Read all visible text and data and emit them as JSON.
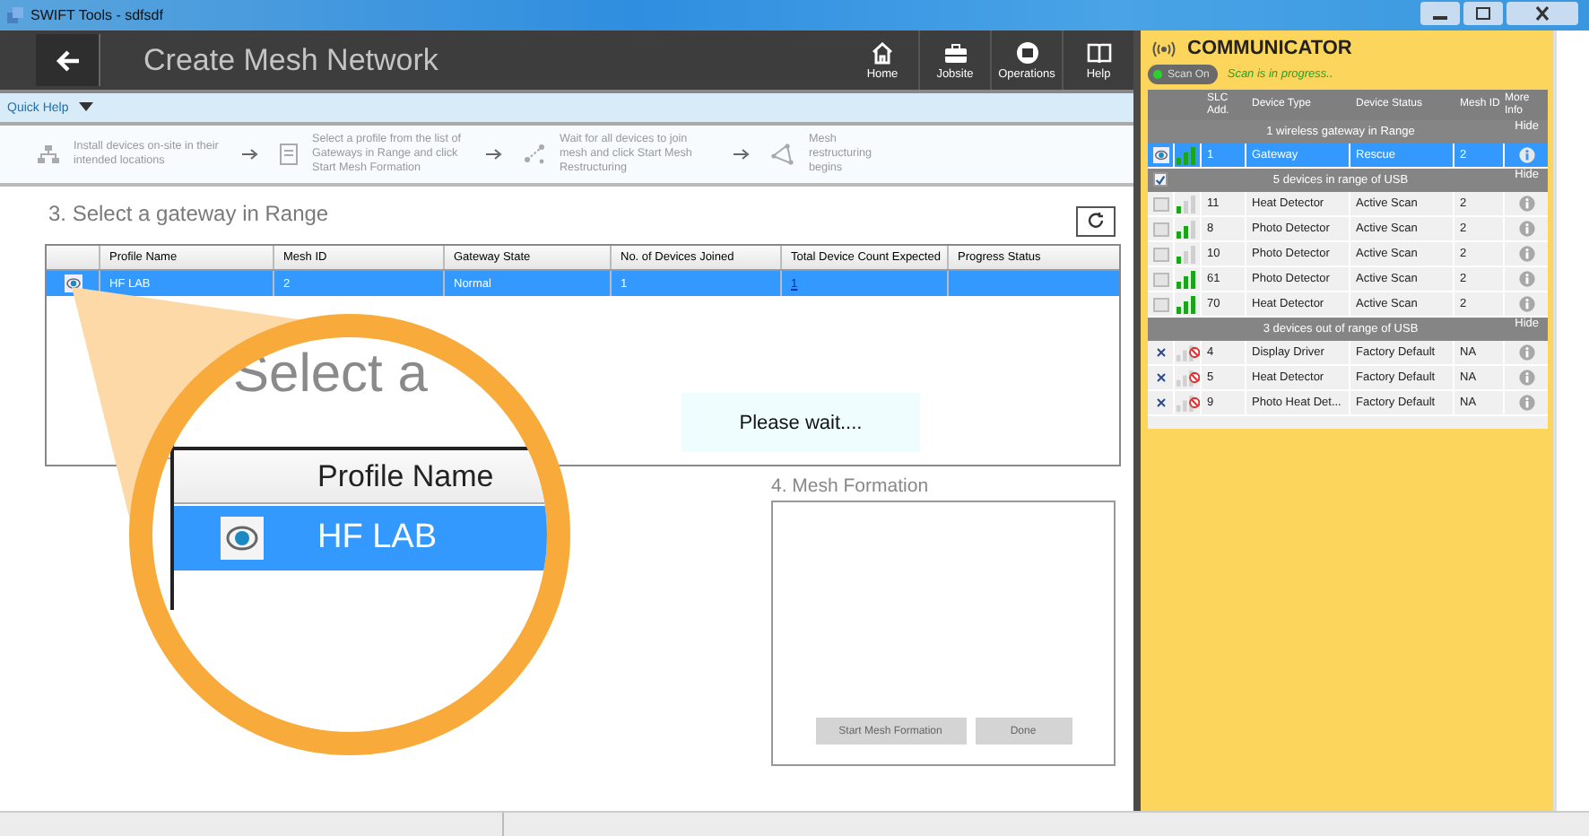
{
  "window": {
    "title": "SWIFT Tools - sdfsdf"
  },
  "header": {
    "title": "Create Mesh Network",
    "nav": [
      {
        "kind": "home",
        "label": "Home"
      },
      {
        "kind": "jobsite",
        "label": "Jobsite"
      },
      {
        "kind": "operations",
        "label": "Operations"
      },
      {
        "kind": "help",
        "label": "Help"
      }
    ]
  },
  "quick_help": {
    "label": "Quick Help",
    "expanded": true
  },
  "steps": [
    {
      "kind": "install",
      "text": "Install devices on-site in their intended locations"
    },
    {
      "kind": "select",
      "text": "Select a profile from the list of Gateways in Range and click Start Mesh Formation"
    },
    {
      "kind": "wait",
      "text": "Wait for all devices to join mesh and click Start Mesh Restructuring"
    },
    {
      "kind": "restructure",
      "text": "Mesh restructuring begins"
    }
  ],
  "gateways": {
    "title": "3. Select a gateway in Range",
    "columns": [
      "Profile Name",
      "Mesh ID",
      "Gateway State",
      "No. of Devices Joined",
      "Total Device Count Expected",
      "Progress Status"
    ],
    "rows": [
      {
        "selected": true,
        "cells": [
          "HF LAB",
          "2",
          "Normal",
          "1",
          "1"
        ]
      }
    ]
  },
  "wait_message": "Please wait....",
  "magnifier": {
    "heading": "Select a",
    "column": "Profile Name",
    "row_text": "HF LAB"
  },
  "mesh_formation": {
    "title": "4. Mesh Formation",
    "buttons": [
      {
        "label": "Start Mesh Formation",
        "disabled": true
      },
      {
        "label": "Done",
        "disabled": true
      }
    ]
  },
  "communicator": {
    "title": "COMMUNICATOR",
    "scan_button": {
      "label": "Scan On",
      "on": true
    },
    "scan_status": "Scan is in progress..",
    "columns": [
      "SLC Add.",
      "Device Type",
      "Device Status",
      "Mesh ID",
      "More Info"
    ],
    "groups": [
      {
        "kind": "gateway",
        "title": "1 wireless gateway in Range",
        "action": "Hide",
        "rows": [
          {
            "kind": "gateway",
            "selected": true,
            "signal_bars": [
              true,
              true,
              true
            ],
            "cells": [
              "1",
              "Gateway",
              "Rescue",
              "2"
            ]
          }
        ]
      },
      {
        "kind": "usb",
        "title": "5 devices in range of USB",
        "action": "Hide",
        "checked": true,
        "rows": [
          {
            "kind": "usb",
            "checked": false,
            "signal_bars": [
              true,
              false,
              false
            ],
            "cells": [
              "11",
              "Heat Detector",
              "Active Scan",
              "2"
            ]
          },
          {
            "kind": "usb",
            "checked": false,
            "signal_bars": [
              true,
              true,
              false
            ],
            "cells": [
              "8",
              "Photo Detector",
              "Active Scan",
              "2"
            ]
          },
          {
            "kind": "usb",
            "checked": false,
            "signal_bars": [
              true,
              false,
              false
            ],
            "cells": [
              "10",
              "Photo Detector",
              "Active Scan",
              "2"
            ]
          },
          {
            "kind": "usb",
            "checked": false,
            "signal_bars": [
              true,
              true,
              true
            ],
            "cells": [
              "61",
              "Photo Detector",
              "Active Scan",
              "2"
            ]
          },
          {
            "kind": "usb",
            "checked": false,
            "signal_bars": [
              true,
              true,
              true
            ],
            "cells": [
              "70",
              "Heat Detector",
              "Active Scan",
              "2"
            ]
          }
        ]
      },
      {
        "kind": "offline",
        "title": "3 devices out of range of USB",
        "action": "Hide",
        "rows": [
          {
            "kind": "offline",
            "signal_bars": [
              false,
              false,
              false
            ],
            "cells": [
              "4",
              "Display Driver",
              "Factory Default",
              "NA"
            ]
          },
          {
            "kind": "offline",
            "signal_bars": [
              false,
              false,
              false
            ],
            "cells": [
              "5",
              "Heat Detector",
              "Factory Default",
              "NA"
            ]
          },
          {
            "kind": "offline",
            "signal_bars": [
              false,
              false,
              false
            ],
            "cells": [
              "9",
              "Photo Heat Det...",
              "Factory Default",
              "NA"
            ]
          }
        ]
      }
    ]
  }
}
